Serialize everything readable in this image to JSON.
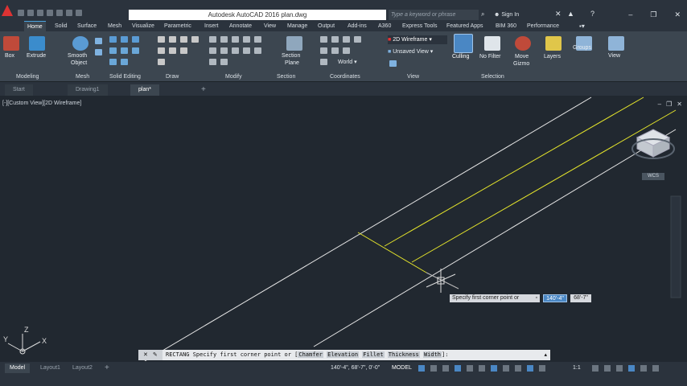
{
  "title_bar": {
    "app_title": "Autodesk AutoCAD 2016    plan.dwg",
    "search_placeholder": "Type a keyword or phrase",
    "sign_in": "Sign In"
  },
  "ribbon_tabs": [
    "Home",
    "Solid",
    "Surface",
    "Mesh",
    "Visualize",
    "Parametric",
    "Insert",
    "Annotate",
    "View",
    "Manage",
    "Output",
    "Add-ins",
    "A360",
    "Express Tools",
    "Featured Apps",
    "BIM 360",
    "Performance"
  ],
  "ribbon": {
    "buttons": {
      "box": "Box",
      "extrude": "Extrude",
      "smooth_object_1": "Smooth",
      "smooth_object_2": "Object",
      "section_plane_1": "Section",
      "section_plane_2": "Plane",
      "culling": "Culling",
      "no_filter": "No Filter",
      "move_gizmo_1": "Move",
      "move_gizmo_2": "Gizmo",
      "layers": "Layers",
      "groups": "Groups",
      "view": "View"
    },
    "dropdowns": {
      "visual_style": "2D Wireframe",
      "unsaved_view": "Unsaved View",
      "ucs_world": "World"
    },
    "groups": [
      "Modeling",
      "Mesh",
      "Solid Editing",
      "Draw",
      "Modify",
      "Section",
      "Coordinates",
      "View",
      "Selection"
    ]
  },
  "doc_tabs": [
    "Start",
    "Drawing1",
    "plan*"
  ],
  "viewport": {
    "label": "[-][Custom View][2D Wireframe]",
    "viewcube_label": "WCS",
    "ucs_x": "X",
    "ucs_y": "Y",
    "ucs_z": "Z"
  },
  "dynamic_input": {
    "prompt": "Specify first corner point or",
    "x_value": "140'-4\"",
    "y_value": "68'-7\""
  },
  "command_line": {
    "command": "RECTANG Specify first corner point or [",
    "options": [
      "Chamfer",
      "Elevation",
      "Fillet",
      "Thickness",
      "Width"
    ],
    "suffix": "]:"
  },
  "status_bar": {
    "layout_tabs": [
      "Model",
      "Layout1",
      "Layout2"
    ],
    "coordinates": "140'-4\", 68'-7\", 0'-0\"",
    "model_label": "MODEL",
    "scale": "1:1"
  },
  "colors": {
    "viewport_bg": "#212830",
    "line_white": "#e6e6e6",
    "line_yellow": "#e5e52b",
    "accent": "#4aa3df"
  }
}
